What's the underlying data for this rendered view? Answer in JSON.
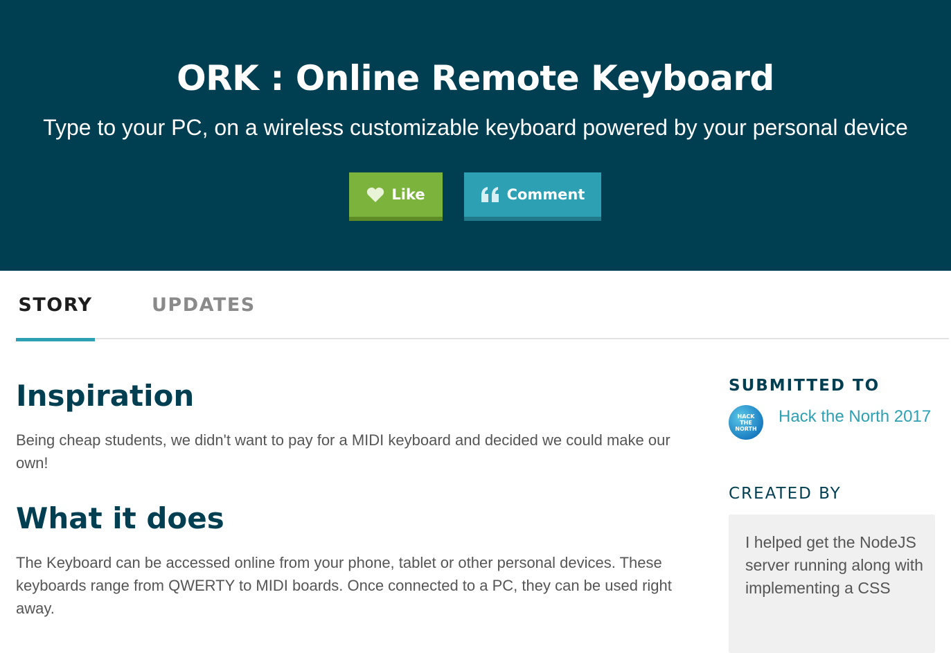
{
  "hero": {
    "title": "ORK : Online Remote Keyboard",
    "subtitle": "Type to your PC, on a wireless customizable keyboard powered by your personal device",
    "like_label": "Like",
    "comment_label": "Comment"
  },
  "tabs": [
    {
      "label": "STORY",
      "active": true
    },
    {
      "label": "UPDATES",
      "active": false
    }
  ],
  "story": {
    "sections": [
      {
        "heading": "Inspiration",
        "body": "Being cheap students, we didn't want to pay for a MIDI keyboard and decided we could make our own!"
      },
      {
        "heading": "What it does",
        "body": "The Keyboard can be accessed online from your phone, tablet or other personal devices. These keyboards range from QWERTY to MIDI boards. Once connected to a PC, they can be used right away."
      }
    ]
  },
  "sidebar": {
    "submitted_heading": "SUBMITTED TO",
    "hackathon": {
      "name": "Hack the North 2017",
      "logo_text": [
        "HACK",
        "THE",
        "NORTH"
      ]
    },
    "created_heading": "CREATED BY",
    "creator_note": "I helped get the NodeJS server running along with implementing a CSS"
  },
  "colors": {
    "hero_bg": "#003e52",
    "like": "#7cb33c",
    "comment": "#2ea0b3",
    "accent": "#2ea0b3",
    "heading": "#003e52",
    "body_text": "#555555"
  },
  "icons": {
    "like": "heart-icon",
    "comment": "quote-icon"
  }
}
